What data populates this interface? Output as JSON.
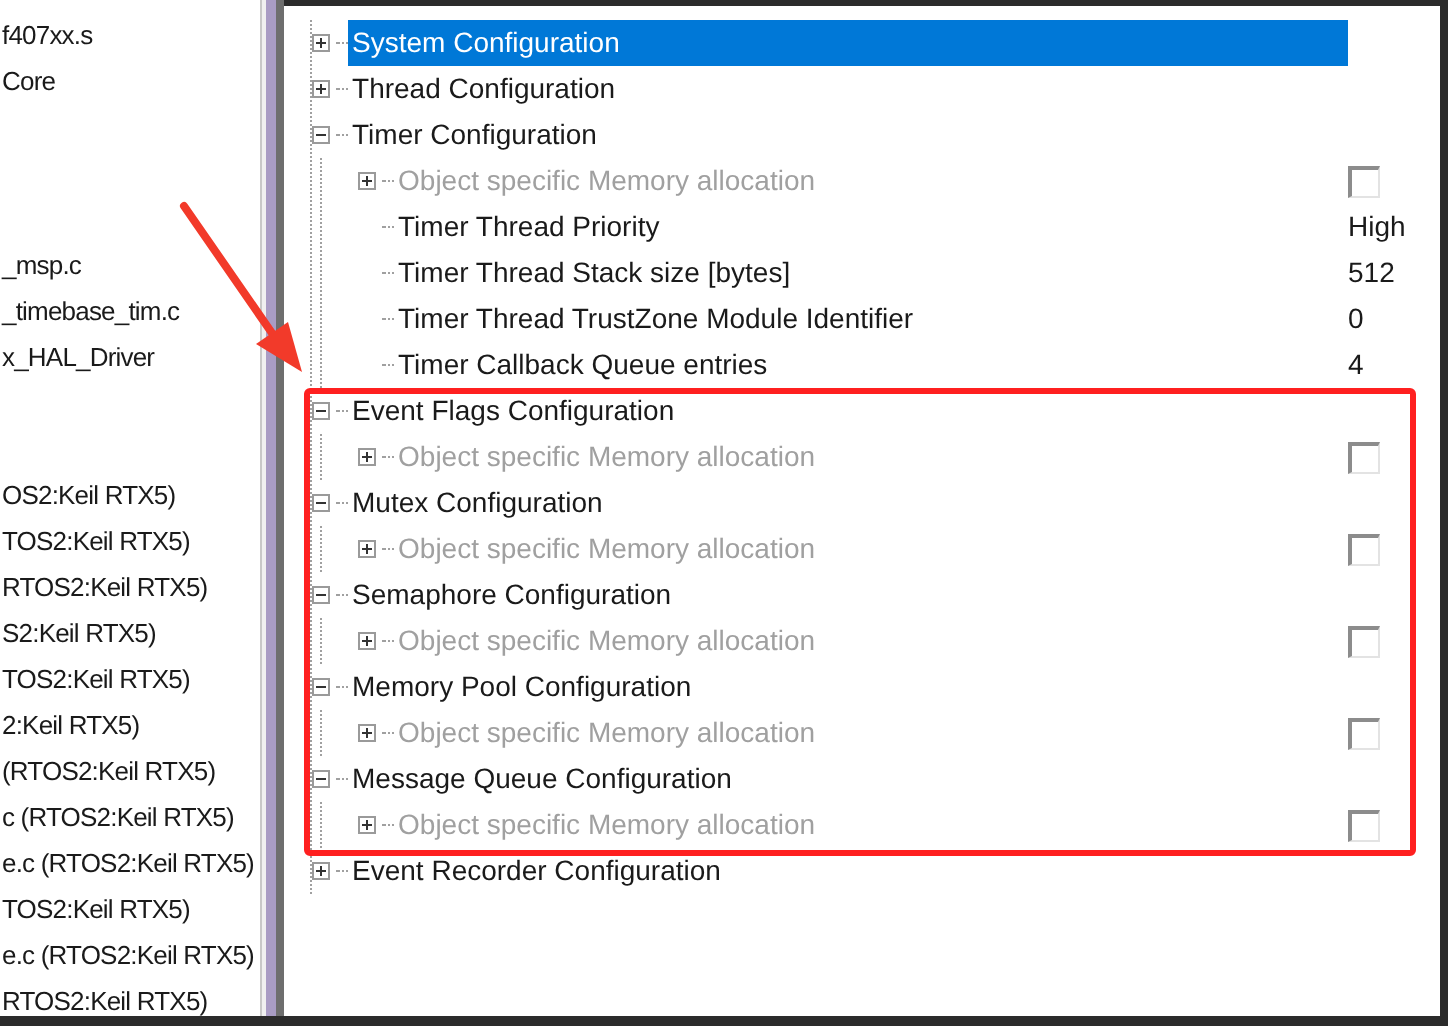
{
  "file_list": [
    {
      "kind": "file",
      "label": "f407xx.s"
    },
    {
      "kind": "file",
      "label": "Core"
    },
    {
      "kind": "spacer"
    },
    {
      "kind": "spacer"
    },
    {
      "kind": "spacer"
    },
    {
      "kind": "file",
      "label": "_msp.c"
    },
    {
      "kind": "file",
      "label": "_timebase_tim.c"
    },
    {
      "kind": "file",
      "label": "x_HAL_Driver"
    },
    {
      "kind": "spacer"
    },
    {
      "kind": "spacer"
    },
    {
      "kind": "file",
      "label": "OS2:Keil RTX5)"
    },
    {
      "kind": "file",
      "label": "TOS2:Keil RTX5)"
    },
    {
      "kind": "file",
      "label": "RTOS2:Keil RTX5)"
    },
    {
      "kind": "file",
      "label": "S2:Keil RTX5)"
    },
    {
      "kind": "file",
      "label": "TOS2:Keil RTX5)"
    },
    {
      "kind": "file",
      "label": "2:Keil RTX5)"
    },
    {
      "kind": "file",
      "label": "(RTOS2:Keil RTX5)"
    },
    {
      "kind": "file",
      "label": "c (RTOS2:Keil RTX5)"
    },
    {
      "kind": "file",
      "label": "e.c (RTOS2:Keil RTX5)"
    },
    {
      "kind": "file",
      "label": "TOS2:Keil RTX5)"
    },
    {
      "kind": "file",
      "label": "e.c (RTOS2:Keil RTX5)"
    },
    {
      "kind": "file",
      "label": "RTOS2:Keil RTX5)"
    }
  ],
  "config_tree": [
    {
      "kind": "group",
      "label": "System Configuration",
      "expanded": false,
      "selected": true
    },
    {
      "kind": "group",
      "label": "Thread Configuration",
      "expanded": false,
      "selected": false
    },
    {
      "kind": "group",
      "label": "Timer Configuration",
      "expanded": true,
      "selected": false,
      "children": [
        {
          "kind": "checkbox",
          "label": "Object specific Memory allocation",
          "expanded": false,
          "disabled": true,
          "checked": false
        },
        {
          "kind": "value",
          "label": "Timer Thread Priority",
          "value": "High"
        },
        {
          "kind": "value",
          "label": "Timer Thread Stack size [bytes]",
          "value": "512"
        },
        {
          "kind": "value",
          "label": "Timer Thread TrustZone Module Identifier",
          "value": "0"
        },
        {
          "kind": "value",
          "label": "Timer Callback Queue entries",
          "value": "4"
        }
      ]
    },
    {
      "kind": "group",
      "label": "Event Flags Configuration",
      "expanded": true,
      "selected": false,
      "children": [
        {
          "kind": "checkbox",
          "label": "Object specific Memory allocation",
          "expanded": false,
          "disabled": true,
          "checked": false
        }
      ]
    },
    {
      "kind": "group",
      "label": "Mutex Configuration",
      "expanded": true,
      "selected": false,
      "children": [
        {
          "kind": "checkbox",
          "label": "Object specific Memory allocation",
          "expanded": false,
          "disabled": true,
          "checked": false
        }
      ]
    },
    {
      "kind": "group",
      "label": "Semaphore Configuration",
      "expanded": true,
      "selected": false,
      "children": [
        {
          "kind": "checkbox",
          "label": "Object specific Memory allocation",
          "expanded": false,
          "disabled": true,
          "checked": false
        }
      ]
    },
    {
      "kind": "group",
      "label": "Memory Pool Configuration",
      "expanded": true,
      "selected": false,
      "children": [
        {
          "kind": "checkbox",
          "label": "Object specific Memory allocation",
          "expanded": false,
          "disabled": true,
          "checked": false
        }
      ]
    },
    {
      "kind": "group",
      "label": "Message Queue Configuration",
      "expanded": true,
      "selected": false,
      "children": [
        {
          "kind": "checkbox",
          "label": "Object specific Memory allocation",
          "expanded": false,
          "disabled": true,
          "checked": false
        }
      ]
    },
    {
      "kind": "group",
      "label": "Event Recorder Configuration",
      "expanded": false,
      "selected": false
    }
  ]
}
